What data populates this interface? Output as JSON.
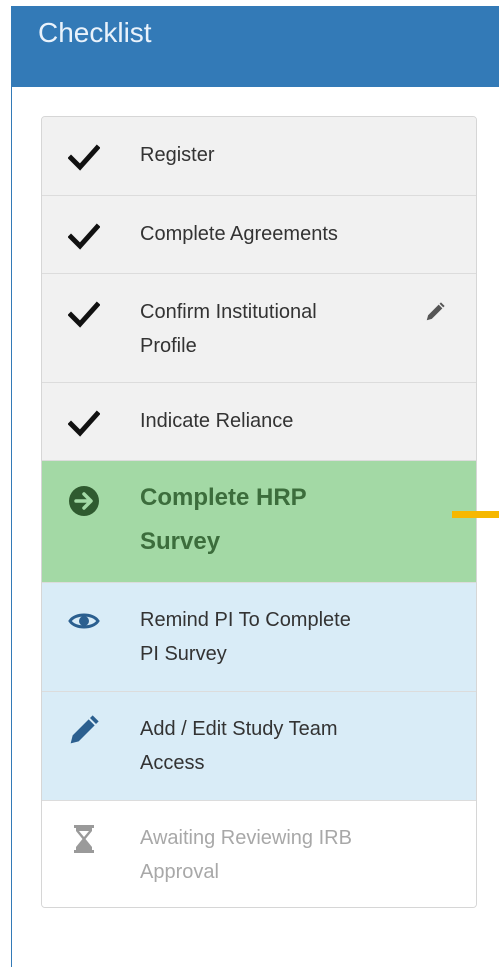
{
  "panel": {
    "title": "Checklist"
  },
  "items": [
    {
      "label": "Register"
    },
    {
      "label": "Complete Agreements"
    },
    {
      "label": "Confirm Institutional",
      "label2": "Profile"
    },
    {
      "label": "Indicate Reliance"
    },
    {
      "label": "Complete HRP",
      "label2": "Survey"
    },
    {
      "label": "Remind PI To Complete",
      "label2": "PI Survey"
    },
    {
      "label": "Add / Edit Study Team",
      "label2": "Access"
    },
    {
      "label": "Awaiting Reviewing IRB",
      "label2": "Approval"
    }
  ],
  "colors": {
    "header": "#337ab7",
    "done_bg": "#f1f1f1",
    "active_bg": "#a3d9a5",
    "active_text": "#3c6d3c",
    "info_bg": "#d9ecf7",
    "disabled_text": "#a8a8a8",
    "pointer": "#f6b800"
  },
  "icons": {
    "done": "checkmark-icon",
    "edit": "pencil-icon",
    "active": "arrow-circle-right-icon",
    "remind": "eye-icon",
    "access": "pencil-icon",
    "waiting": "hourglass-icon"
  }
}
